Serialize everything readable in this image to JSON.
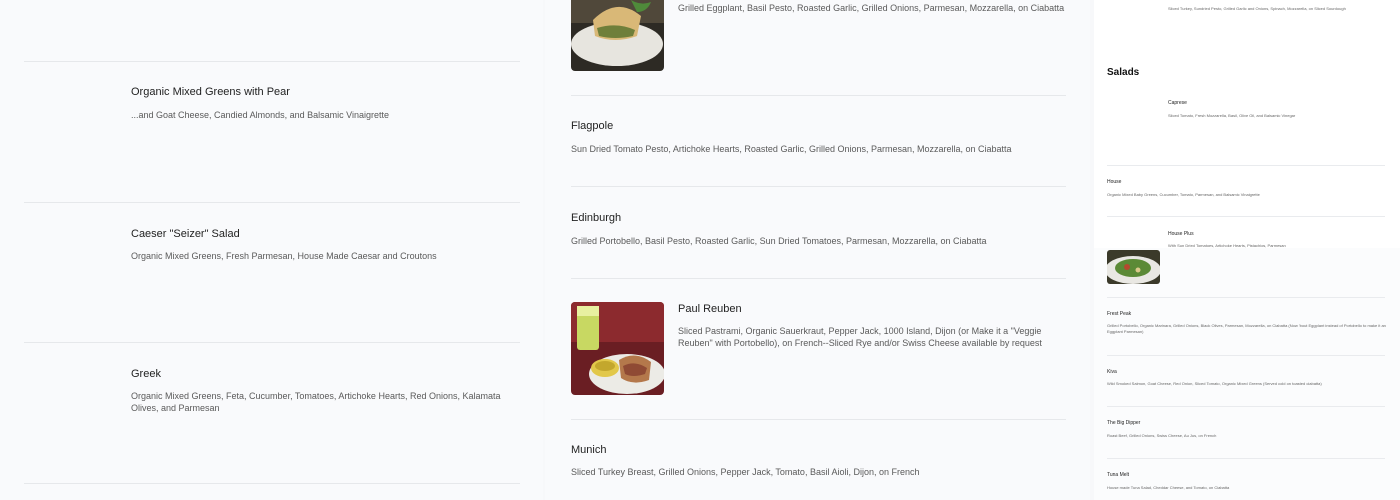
{
  "left_column": {
    "items": [
      {
        "title": "Organic Mixed Greens with Pear",
        "desc": "...and Goat Cheese, Candied Almonds, and Balsamic Vinaigrette"
      },
      {
        "title": "Caeser \"Seizer\" Salad",
        "desc": "Organic Mixed Greens, Fresh Parmesan, House Made Caesar and Croutons"
      },
      {
        "title": "Greek",
        "desc": "Organic Mixed Greens, Feta, Cucumber, Tomatoes, Artichoke Hearts, Red Onions, Kalamata Olives, and Parmesan"
      }
    ]
  },
  "middle_column": {
    "items": [
      {
        "title": "",
        "desc": "Grilled Eggplant, Basil Pesto, Roasted Garlic, Grilled Onions, Parmesan, Mozzarella, on Ciabatta"
      },
      {
        "title": "Flagpole",
        "desc": "Sun Dried Tomato Pesto, Artichoke Hearts, Roasted Garlic, Grilled Onions, Parmesan, Mozzarella, on Ciabatta"
      },
      {
        "title": "Edinburgh",
        "desc": "Grilled Portobello, Basil Pesto, Roasted Garlic, Sun Dried Tomatoes, Parmesan, Mozzarella, on Ciabatta"
      },
      {
        "title": "Paul Reuben",
        "desc": "Sliced Pastrami, Organic Sauerkraut, Pepper Jack, 1000 Island, Dijon (or Make it a \"Veggie Reuben\" with Portobello), on French--Sliced Rye and/or Swiss Cheese available by request"
      },
      {
        "title": "Munich",
        "desc": "Sliced Turkey Breast, Grilled Onions, Pepper Jack, Tomato, Basil Aioli, Dijon, on French"
      }
    ]
  },
  "right_column": {
    "top_desc": "Sliced Turkey, Sundried Pesto, Grilled Garlic and Onions, Spinach, Mozzarella, on Sliced Sourdough",
    "section_title": "Salads",
    "items": [
      {
        "title": "Caprese",
        "desc": "Sliced Tomato, Fresh Mozzarella, Basil, Olive Oil, and Balsamic Vinegar"
      },
      {
        "title": "House",
        "desc": "Organic Mixed Baby Greens, Cucumber, Tomato, Parmesan, and Balsamic Vinaigrette"
      },
      {
        "title": "House Plus",
        "desc": "With Sun Dried Tomatoes, Artichoke Hearts, Pistachios, Parmesan"
      },
      {
        "title": "Frest Peak",
        "desc": "Grilled Portobello, Organic Marinara, Grilled Onions, Black Olives, Parmesan, Mozzarella, on Ciabatta (Now 'bout Eggplant instead of Portobello to make it an Eggplant Parmesan)"
      },
      {
        "title": "Kiva",
        "desc": "Wild Smoked Salmon, Goat Cheese, Red Onion, Sliced Tomato, Organic Mixed Greens (Served cold on toasted ciabatta)"
      },
      {
        "title": "The Big Dipper",
        "desc": "Roast Beef, Grilled Onions, Swiss Cheese, Au Jus, on French"
      },
      {
        "title": "Tuna Melt",
        "desc": "House made Tuna Salad, Cheddar Cheese, and Tomato, on Ciabatta"
      }
    ]
  },
  "colors": {
    "background": "#f9fafc",
    "divider": "#e6e8eb",
    "text": "#222222",
    "muted": "#5a5a5a"
  }
}
